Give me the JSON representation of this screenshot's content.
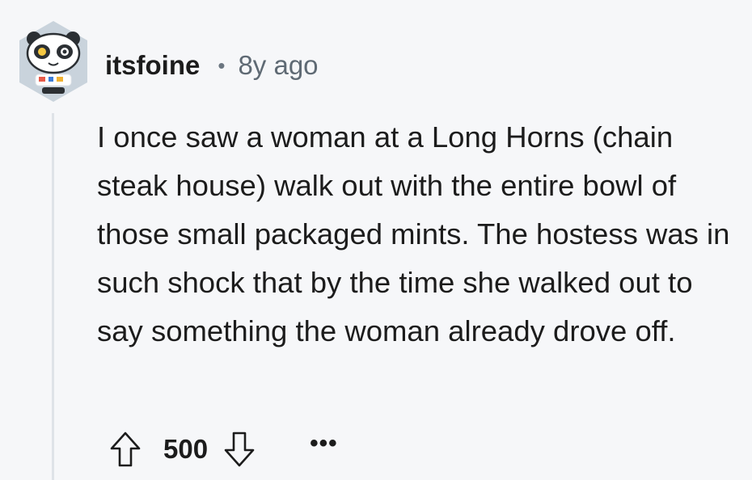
{
  "comment": {
    "author": "itsfoine",
    "separator": "•",
    "age": "8y ago",
    "body": "I once saw a woman at a Long Horns (chain steak house) walk out with the entire bowl of those small packaged mints. The hostess was in such shock that by the time she walked out to say something the woman already drove off.",
    "score": "500",
    "more_label": "•••"
  },
  "icons": {
    "avatar": "snoo-avatar-icon",
    "upvote": "upvote-arrow-icon",
    "downvote": "downvote-arrow-icon",
    "more": "more-options-icon"
  },
  "colors": {
    "background": "#f6f7f9",
    "text": "#1c1c1c",
    "meta": "#5f6a74",
    "thread_line": "#dfe3e8",
    "avatar_bg": "#c9d3dc"
  }
}
